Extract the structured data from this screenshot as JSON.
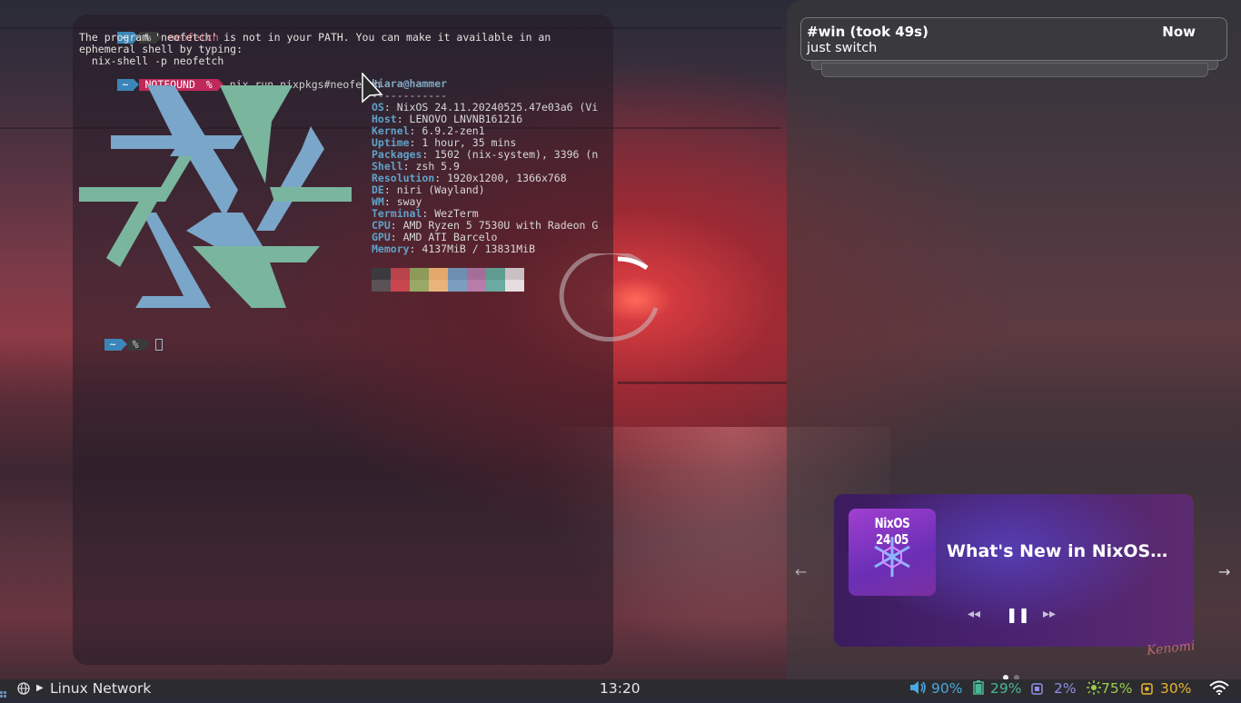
{
  "terminal": {
    "lines": {
      "l1_cmd": "neofetch",
      "l2": "The program 'neofetch' is not in your PATH. You can make it available in an",
      "l3": "ephemeral shell by typing:",
      "l4": "  nix-shell -p neofetch",
      "l5_cmd": "nix run nixpkgs#neofetch"
    },
    "prompt": {
      "dir": "~",
      "pct": "%",
      "error": "NOTFOUND"
    },
    "fetch": {
      "user": "kiara@hammer",
      "separator": "------------",
      "rows": [
        {
          "k": "OS",
          "v": ": NixOS 24.11.20240525.47e03a6 (Vi"
        },
        {
          "k": "Host",
          "v": ": LENOVO LNVNB161216"
        },
        {
          "k": "Kernel",
          "v": ": 6.9.2-zen1"
        },
        {
          "k": "Uptime",
          "v": ": 1 hour, 35 mins"
        },
        {
          "k": "Packages",
          "v": ": 1502 (nix-system), 3396 (n"
        },
        {
          "k": "Shell",
          "v": ": zsh 5.9"
        },
        {
          "k": "Resolution",
          "v": ": 1920x1200, 1366x768"
        },
        {
          "k": "DE",
          "v": ": niri (Wayland)"
        },
        {
          "k": "WM",
          "v": ": sway"
        },
        {
          "k": "Terminal",
          "v": ": WezTerm"
        },
        {
          "k": "CPU",
          "v": ": AMD Ryzen 5 7530U with Radeon G"
        },
        {
          "k": "GPU",
          "v": ": AMD ATI Barcelo"
        },
        {
          "k": "Memory",
          "v": ": 4137MiB / 13831MiB"
        }
      ],
      "palette_top": [
        "#3b3b3f",
        "#b9434b",
        "#8d9a5a",
        "#e3a86c",
        "#6f8fb0",
        "#a56e98",
        "#5f9c92",
        "#c9c0c4"
      ],
      "palette_bottom": [
        "#5a5256",
        "#c9464f",
        "#9aa866",
        "#e9b47a",
        "#7b9dbf",
        "#b77ca9",
        "#6aaaa0",
        "#e6dde0"
      ],
      "logo_colors": {
        "blue": "#7aa6c9",
        "green": "#7ab59e"
      }
    }
  },
  "notification": {
    "title": "#win (took 49s)",
    "time": "Now",
    "body": "just switch"
  },
  "media": {
    "art_title": "NixOS 24.05",
    "title": "What's New in NixOS…",
    "prev_label": "◂◂",
    "play_label": "❚❚",
    "next_label": "▸▸",
    "left_arrow": "←",
    "right_arrow": "→"
  },
  "bar": {
    "network": "Linux Network",
    "clock": "13:20",
    "volume": "90%",
    "battery": "29%",
    "cpu": "2%",
    "brightness": "75%",
    "temp": "30%",
    "colors": {
      "volume": "#4aa8e0",
      "battery": "#4ab894",
      "cpu": "#8e8ee8",
      "brightness": "#9ccc4a",
      "temp": "#e8b430"
    }
  },
  "wallpaper": {
    "signature": "Kenomi"
  }
}
